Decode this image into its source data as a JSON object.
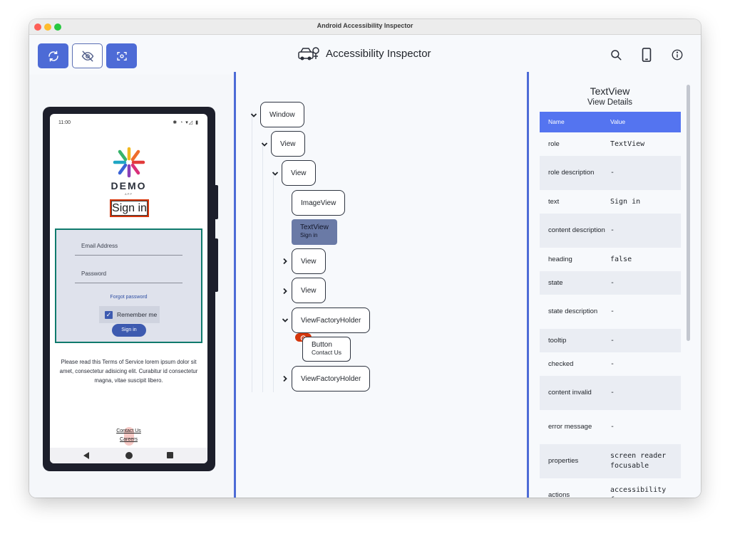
{
  "window": {
    "title": "Android Accessibility Inspector"
  },
  "toolbar": {
    "app_title": "Accessibility Inspector",
    "buttons": [
      {
        "name": "refresh-button",
        "icon": "refresh-icon",
        "active": true
      },
      {
        "name": "toggle-visibility-button",
        "icon": "eye-off-icon",
        "active": false
      },
      {
        "name": "capture-button",
        "icon": "scan-icon",
        "active": true
      }
    ],
    "right_icons": [
      "search-icon",
      "phone-icon",
      "info-icon"
    ]
  },
  "device": {
    "status_time": "11:00",
    "logo_text": "DEMO",
    "logo_subtext": "APP",
    "title": "Sign in",
    "email_label": "Email Address",
    "password_label": "Password",
    "forgot_password": "Forgot password",
    "remember_me": "Remember me",
    "remember_checked": true,
    "signin_button": "Sign in",
    "terms": "Please read this Terms of Service lorem ipsum dolor sit amet, consectetur adisicing elit. Curabitur id consectetur magna, vitae suscipit libero.",
    "contact_link": "Contact Us",
    "careers_link": "Careers"
  },
  "tree": [
    {
      "label": "Window",
      "expanded": true
    },
    {
      "label": "View",
      "expanded": true
    },
    {
      "label": "View",
      "expanded": true
    },
    {
      "label": "ImageView"
    },
    {
      "label": "TextView",
      "sublabel": "Sign in",
      "selected": true
    },
    {
      "label": "View",
      "expanded": false
    },
    {
      "label": "View",
      "expanded": false
    },
    {
      "label": "ViewFactoryHolder",
      "expanded": true
    },
    {
      "label": "Button",
      "sublabel": "Contact Us"
    },
    {
      "label": "ViewFactoryHolder",
      "expanded": false
    }
  ],
  "details": {
    "title": "TextView",
    "subtitle": "View Details",
    "header": {
      "name": "Name",
      "value": "Value"
    },
    "rows": [
      {
        "name": "role",
        "value": "TextView"
      },
      {
        "name": "role description",
        "value": "-"
      },
      {
        "name": "text",
        "value": "Sign in"
      },
      {
        "name": "content description",
        "value": "-"
      },
      {
        "name": "heading",
        "value": "false"
      },
      {
        "name": "state",
        "value": "-"
      },
      {
        "name": "state description",
        "value": "-"
      },
      {
        "name": "tooltip",
        "value": "-"
      },
      {
        "name": "checked",
        "value": "-"
      },
      {
        "name": "content invalid",
        "value": "-"
      },
      {
        "name": "error message",
        "value": "-"
      },
      {
        "name": "properties",
        "value": "screen reader focusable"
      },
      {
        "name": "actions",
        "value": "accessibility focus"
      }
    ]
  },
  "colors": {
    "accent": "#4d6bd6",
    "table_header": "#5474f0",
    "selected_node": "#6a7aa6",
    "highlight": "#d4360c",
    "form_border": "#0f7a6c"
  }
}
